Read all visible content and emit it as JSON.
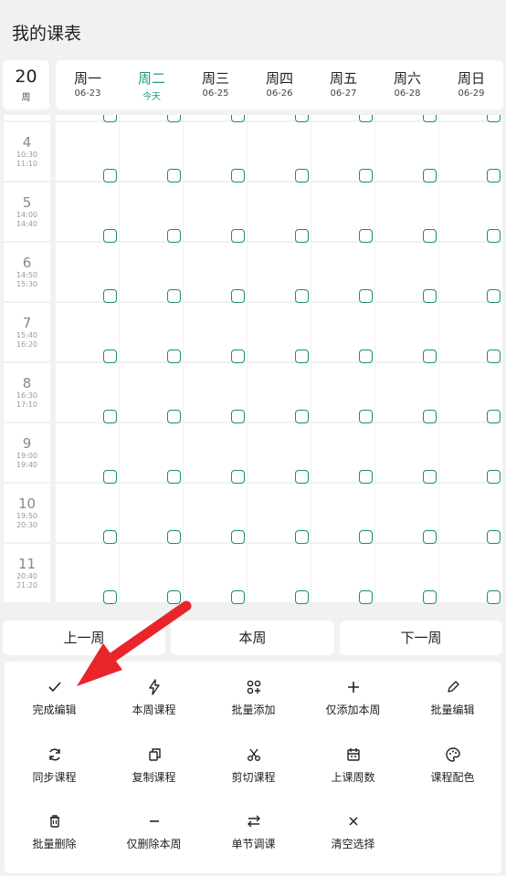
{
  "header": {
    "title": "我的课表"
  },
  "week": {
    "number": "20",
    "unit": "周"
  },
  "days": [
    {
      "name": "周一",
      "date": "06-23",
      "today": false
    },
    {
      "name": "周二",
      "date": "今天",
      "today": true
    },
    {
      "name": "周三",
      "date": "06-25",
      "today": false
    },
    {
      "name": "周四",
      "date": "06-26",
      "today": false
    },
    {
      "name": "周五",
      "date": "06-27",
      "today": false
    },
    {
      "name": "周六",
      "date": "06-28",
      "today": false
    },
    {
      "name": "周日",
      "date": "06-29",
      "today": false
    }
  ],
  "sections": [
    {
      "num": "",
      "start": "",
      "end": ""
    },
    {
      "num": "4",
      "start": "10:30",
      "end": "11:10"
    },
    {
      "num": "5",
      "start": "14:00",
      "end": "14:40"
    },
    {
      "num": "6",
      "start": "14:50",
      "end": "15:30"
    },
    {
      "num": "7",
      "start": "15:40",
      "end": "16:20"
    },
    {
      "num": "8",
      "start": "16:30",
      "end": "17:10"
    },
    {
      "num": "9",
      "start": "19:00",
      "end": "19:40"
    },
    {
      "num": "10",
      "start": "19:50",
      "end": "20:30"
    },
    {
      "num": "11",
      "start": "20:40",
      "end": "21:20"
    }
  ],
  "nav": {
    "prev": "上一周",
    "current": "本周",
    "next": "下一周"
  },
  "actions": [
    {
      "label": "完成编辑",
      "icon": "check-icon"
    },
    {
      "label": "本周课程",
      "icon": "lightning-icon"
    },
    {
      "label": "批量添加",
      "icon": "grid-add-icon"
    },
    {
      "label": "仅添加本周",
      "icon": "plus-icon"
    },
    {
      "label": "批量编辑",
      "icon": "pencil-icon"
    },
    {
      "label": "同步课程",
      "icon": "sync-icon"
    },
    {
      "label": "复制课程",
      "icon": "copy-icon"
    },
    {
      "label": "剪切课程",
      "icon": "scissors-icon"
    },
    {
      "label": "上课周数",
      "icon": "calendar-icon"
    },
    {
      "label": "课程配色",
      "icon": "palette-icon"
    },
    {
      "label": "批量删除",
      "icon": "trash-icon"
    },
    {
      "label": "仅删除本周",
      "icon": "minus-icon"
    },
    {
      "label": "单节调课",
      "icon": "swap-icon"
    },
    {
      "label": "清空选择",
      "icon": "close-icon"
    }
  ],
  "colors": {
    "accent": "#1a9c86",
    "annotation": "#e8262a"
  }
}
